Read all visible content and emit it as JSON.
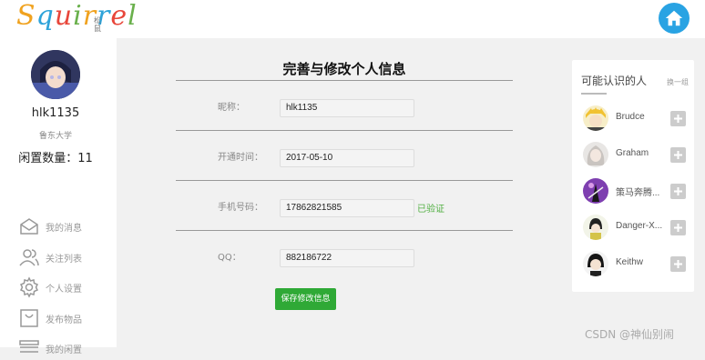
{
  "header": {
    "logo_text": [
      "S",
      "q",
      "u",
      "i",
      "r",
      "r",
      "e",
      "l"
    ],
    "logo_sub": "松鼠",
    "home_icon": "home-icon"
  },
  "profile": {
    "username": "hlk1135",
    "school": "鲁东大学",
    "idle_label": "闲置数量：",
    "idle_count": "11"
  },
  "nav": [
    {
      "label": "我的消息",
      "icon": "mail-icon"
    },
    {
      "label": "关注列表",
      "icon": "users-icon"
    },
    {
      "label": "个人设置",
      "icon": "gear-icon"
    },
    {
      "label": "发布物品",
      "icon": "bag-icon"
    },
    {
      "label": "我的闲置",
      "icon": "list-icon"
    }
  ],
  "form": {
    "title": "完善与修改个人信息",
    "nickname_label": "昵称：",
    "nickname_value": "hlk1135",
    "open_time_label": "开通时间：",
    "open_time_value": "2017-05-10",
    "phone_label": "手机号码：",
    "phone_value": "17862821585",
    "phone_status": "已验证",
    "qq_label": "QQ：",
    "qq_value": "882186722",
    "save_label": "保存修改信息"
  },
  "suggestions": {
    "title": "可能认识的人",
    "refresh": "换一组",
    "people": [
      {
        "name": "Brudce"
      },
      {
        "name": "Graham"
      },
      {
        "name": "策马奔腾..."
      },
      {
        "name": "Danger-X..."
      },
      {
        "name": "Keithw"
      }
    ]
  },
  "watermark": "CSDN @神仙别闹",
  "colors": {
    "accent_green": "#2fa936",
    "home_blue": "#29a3e3",
    "verified_green": "#52b043"
  }
}
